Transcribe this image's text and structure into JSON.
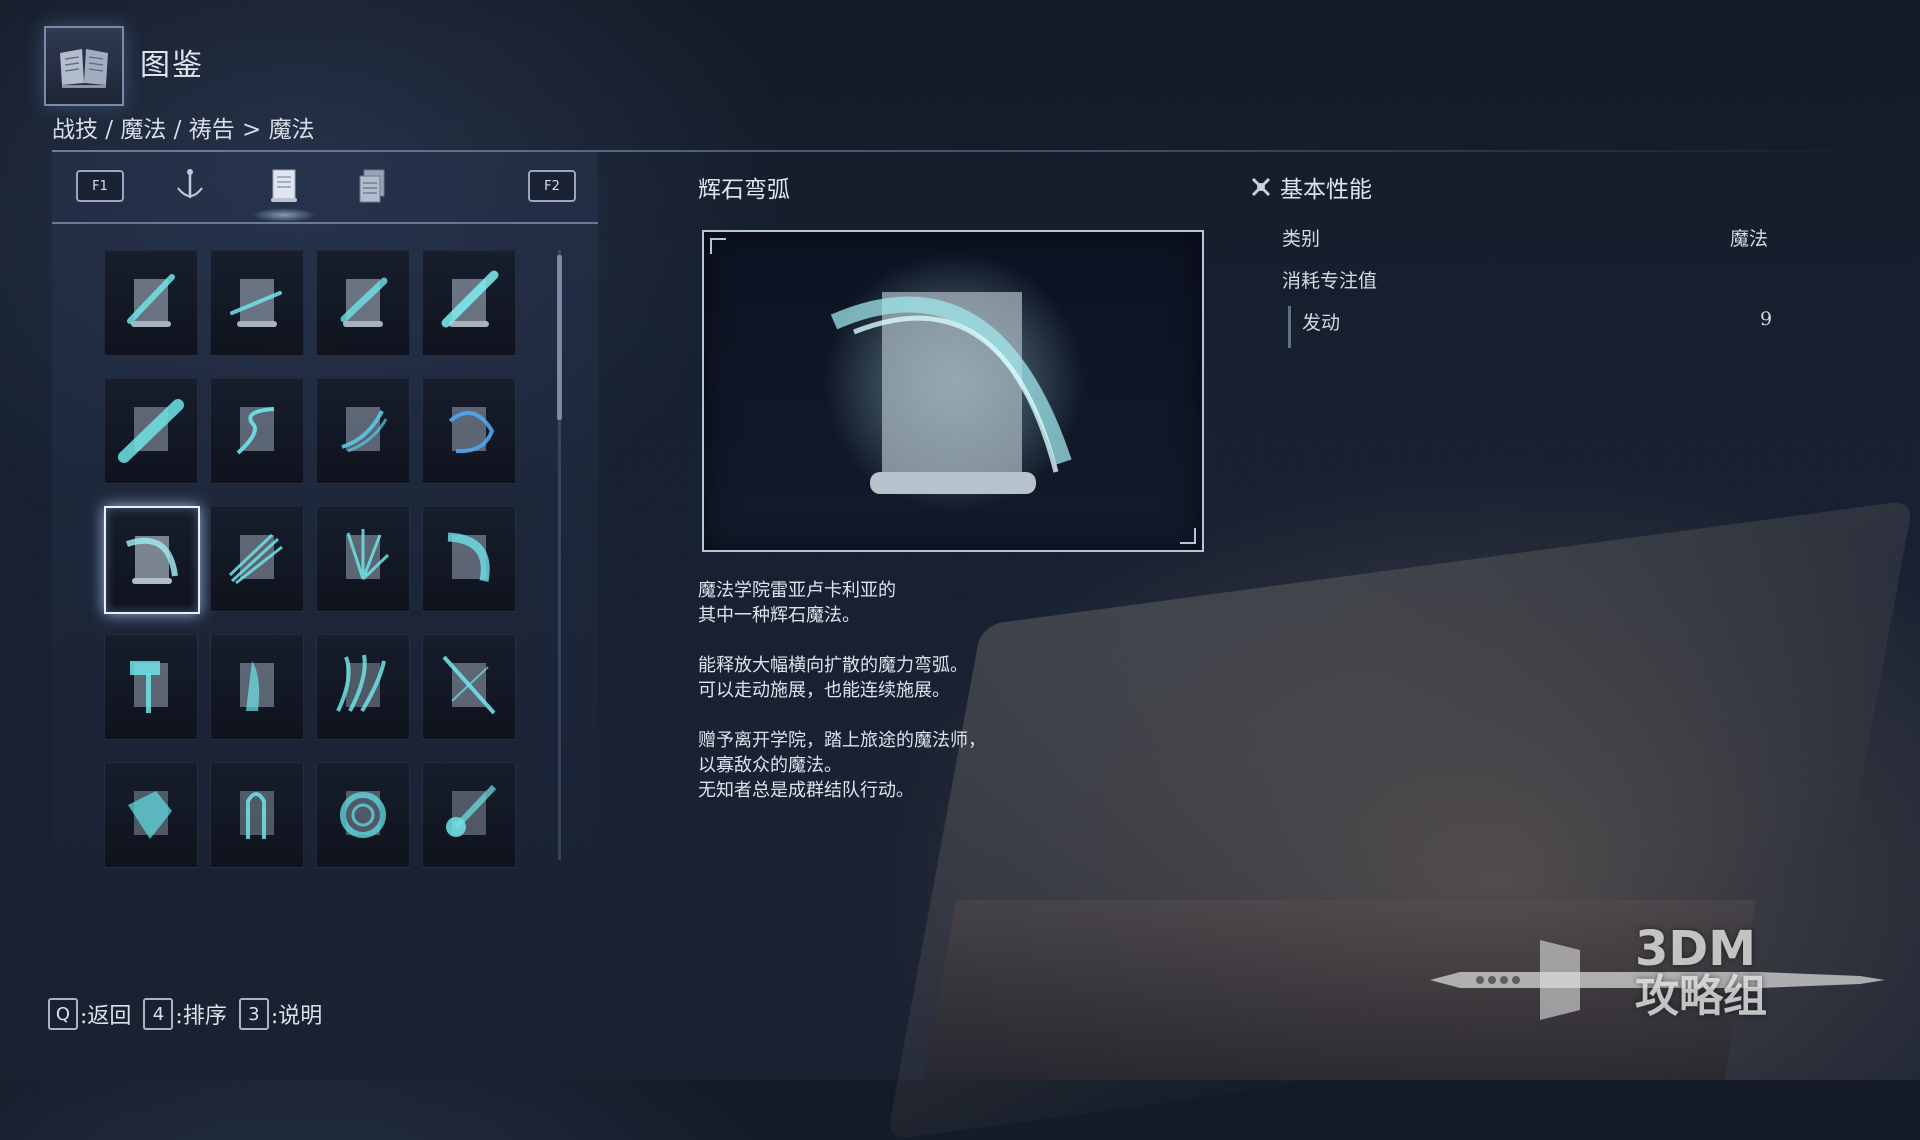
{
  "header": {
    "title": "图鉴",
    "breadcrumb": "战技 / 魔法 / 祷告 > 魔法"
  },
  "tabs": {
    "left_key": "F1",
    "right_key": "F2",
    "icons": [
      "sword-tab-icon",
      "scroll-tab-icon",
      "book-tab-icon"
    ],
    "active_index": 1
  },
  "grid": {
    "rows": 5,
    "cols": 4,
    "selected_index": 8
  },
  "detail": {
    "name": "辉石弯弧",
    "description": [
      "魔法学院雷亚卢卡利亚的\n其中一种辉石魔法。",
      "能释放大幅横向扩散的魔力弯弧。\n可以走动施展，也能连续施展。",
      "赠予离开学院，踏上旅途的魔法师，\n以寡敌众的魔法。\n无知者总是成群结队行动。"
    ]
  },
  "stats": {
    "title": "基本性能",
    "category_label": "类别",
    "category_value": "魔法",
    "fp_label": "消耗专注值",
    "activate_label": "发动",
    "activate_value": "9"
  },
  "footer": [
    {
      "key": "Q",
      "label": ":返回"
    },
    {
      "key": "4",
      "label": ":排序"
    },
    {
      "key": "3",
      "label": ":说明"
    }
  ],
  "watermark": {
    "line1": "3DM",
    "line2": "攻略组"
  },
  "colors": {
    "accent": "#9fe6ea",
    "frame": "#b7c3d8",
    "text": "#dde3ec"
  }
}
